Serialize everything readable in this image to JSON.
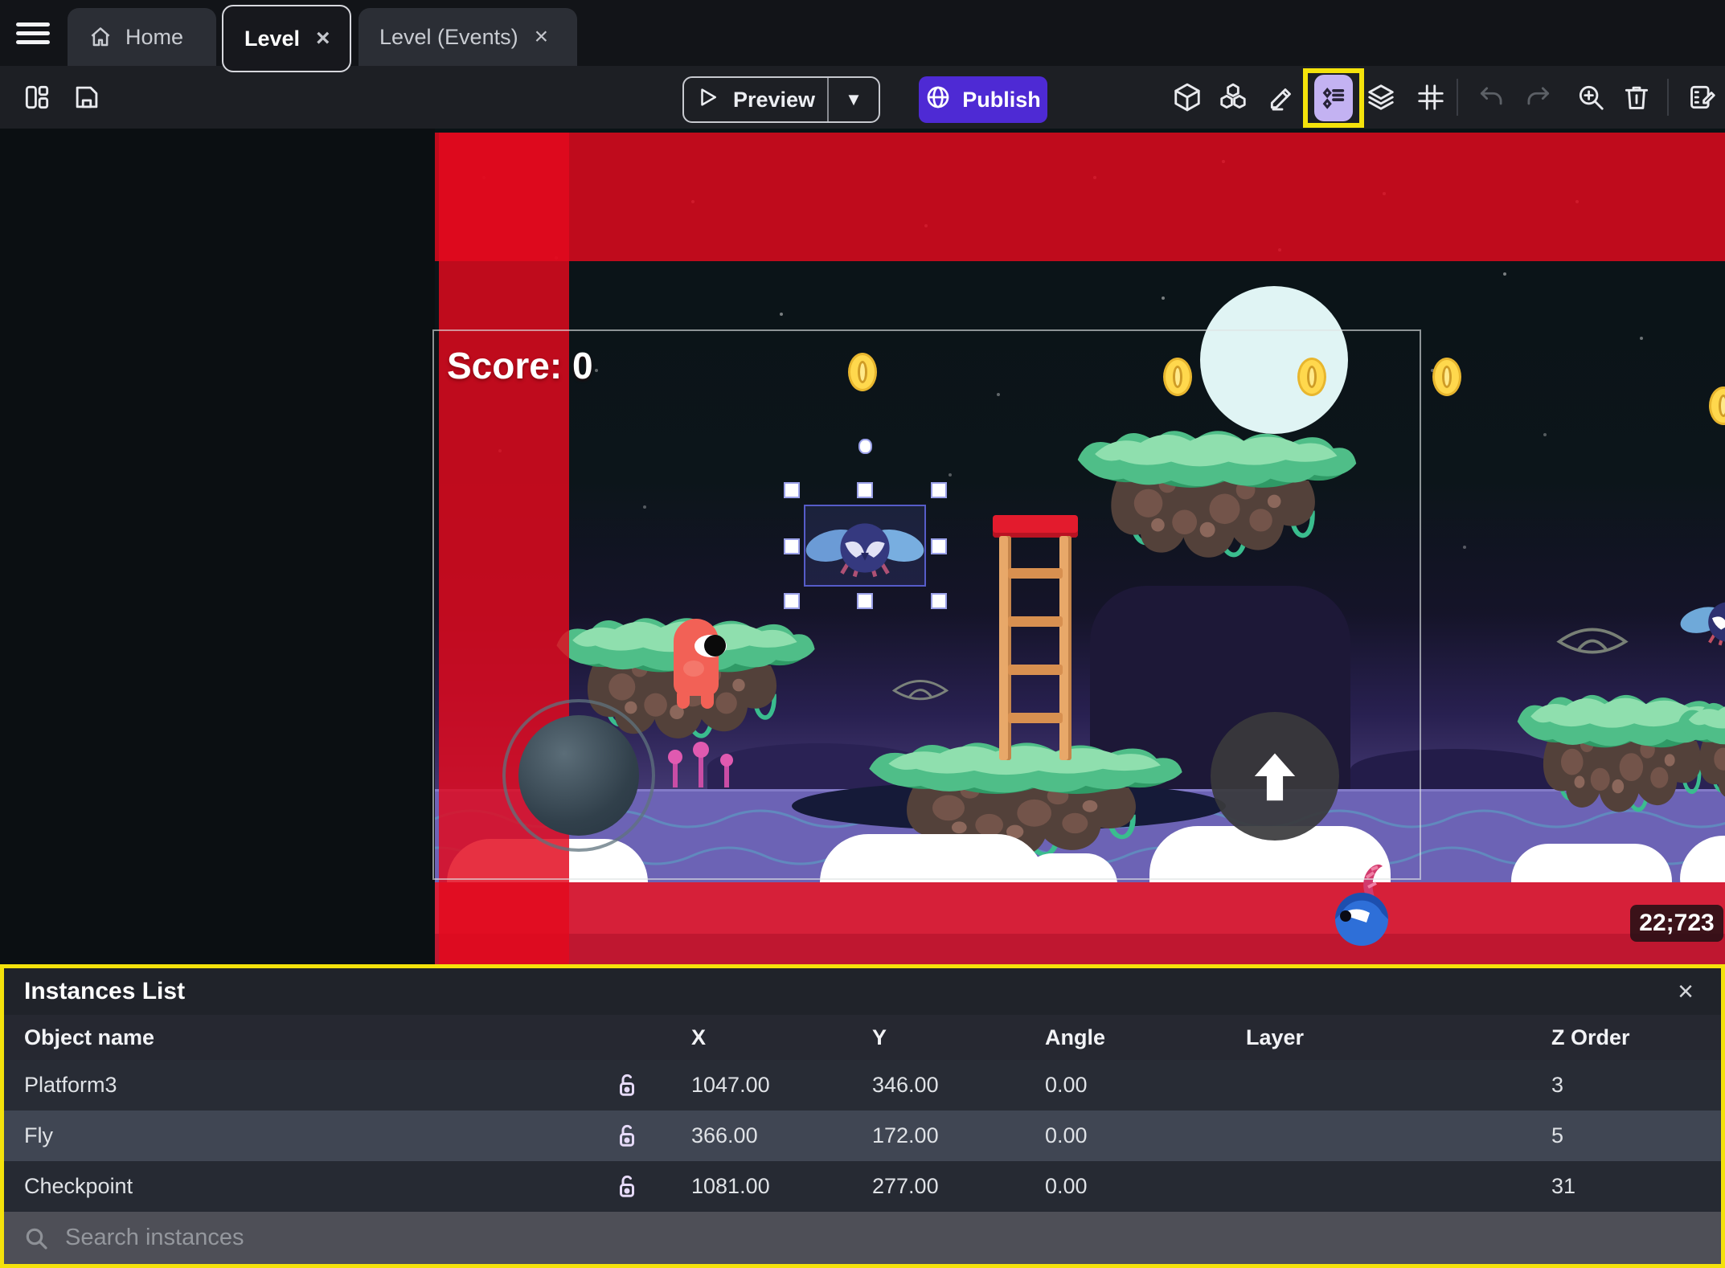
{
  "tab_bar": {
    "close_icon": "×",
    "tabs": [
      {
        "label": "Home",
        "icon": "home-icon",
        "active": false,
        "closable": false
      },
      {
        "label": "Level",
        "active": true,
        "closable": true
      },
      {
        "label": "Level (Events)",
        "active": false,
        "closable": true
      }
    ]
  },
  "toolbar": {
    "preview_label": "Preview",
    "publish_label": "Publish",
    "left_icons": [
      "layout-icon",
      "save-icon"
    ],
    "right_icons": [
      "objects-icon",
      "object-groups-icon",
      "edit-properties-icon",
      "instances-list-icon",
      "layers-icon",
      "grid-icon",
      "undo-icon",
      "redo-icon",
      "zoom-in-icon",
      "delete-icon",
      "edit-scene-icon"
    ],
    "selected_tool": "instances-list-icon"
  },
  "canvas": {
    "score_label": "Score: 0",
    "coords_badge": "22;723",
    "sprites": [
      "player",
      "fly-selected",
      "blue-enemy",
      "coins",
      "platforms",
      "ladder",
      "moon"
    ]
  },
  "instances_panel": {
    "title": "Instances List",
    "close_icon": "×",
    "columns": [
      "Object name",
      "X",
      "Y",
      "Angle",
      "Layer",
      "Z Order"
    ],
    "rows": [
      {
        "name": "Platform3",
        "x": "1047.00",
        "y": "346.00",
        "angle": "0.00",
        "layer": "",
        "z_order": "3"
      },
      {
        "name": "Fly",
        "x": "366.00",
        "y": "172.00",
        "angle": "0.00",
        "layer": "",
        "z_order": "5"
      },
      {
        "name": "Checkpoint",
        "x": "1081.00",
        "y": "277.00",
        "angle": "0.00",
        "layer": "",
        "z_order": "31"
      }
    ],
    "search_placeholder": "Search instances"
  },
  "colors": {
    "accent_purple": "#4e2ad4",
    "highlight_yellow": "#f4e20b",
    "selected_tool_bg": "#c3b2f2",
    "red_overlay": "#e20a1e"
  }
}
